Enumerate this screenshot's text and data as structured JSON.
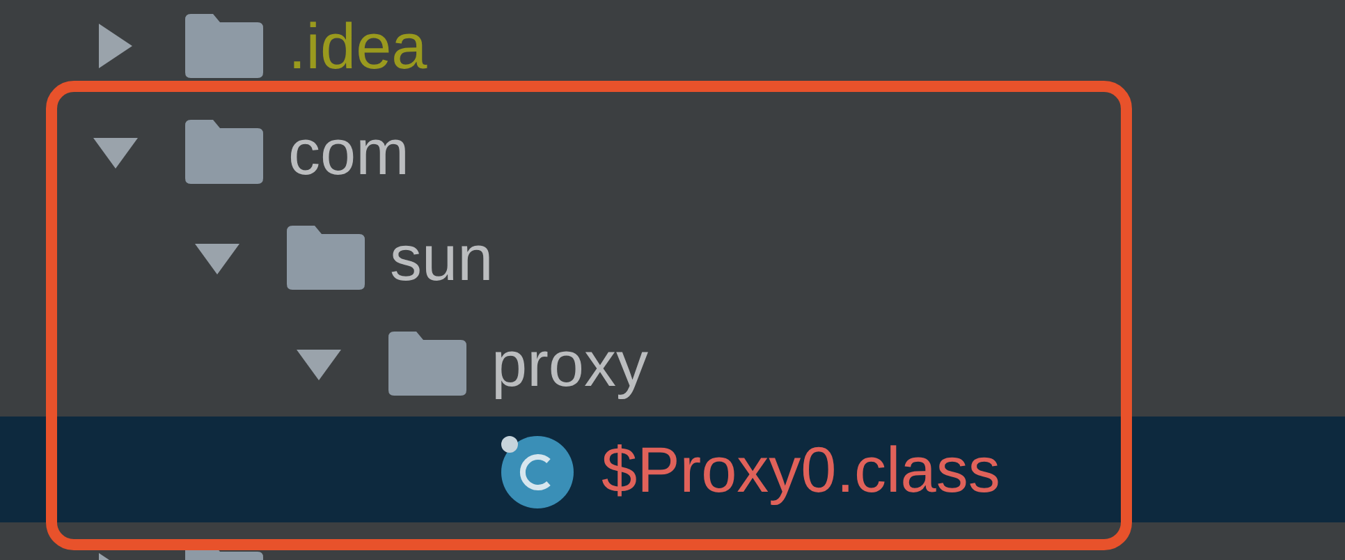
{
  "tree": [
    {
      "kind": "folder",
      "name": ".idea",
      "expanded": false,
      "selected": false,
      "color": "#9a9a1e"
    },
    {
      "kind": "folder",
      "name": "com",
      "expanded": true,
      "selected": false,
      "color": "#bbbdbf",
      "children": [
        {
          "kind": "folder",
          "name": "sun",
          "expanded": true,
          "selected": false,
          "color": "#bbbdbf",
          "children": [
            {
              "kind": "folder",
              "name": "proxy",
              "expanded": true,
              "selected": false,
              "color": "#bbbdbf",
              "children": [
                {
                  "kind": "class",
                  "name": "$Proxy0.class",
                  "selected": true,
                  "color": "#e0625a"
                }
              ]
            }
          ]
        }
      ]
    },
    {
      "kind": "folder",
      "expanded": false,
      "selected": false
    }
  ]
}
